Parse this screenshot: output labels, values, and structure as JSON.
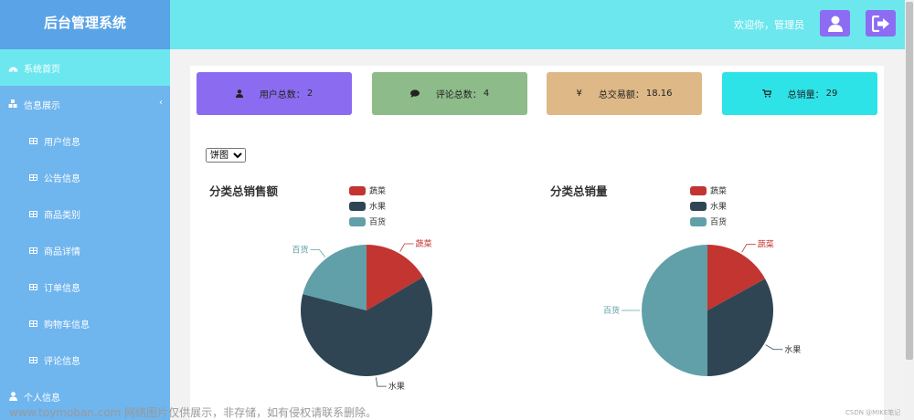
{
  "app": {
    "title": "后台管理系统"
  },
  "header": {
    "welcome": "欢迎你，管理员"
  },
  "sidebar": {
    "items": [
      {
        "label": "系统首页"
      },
      {
        "label": "信息展示"
      },
      {
        "label": "用户信息"
      },
      {
        "label": "公告信息"
      },
      {
        "label": "商品类别"
      },
      {
        "label": "商品详情"
      },
      {
        "label": "订单信息"
      },
      {
        "label": "购物车信息"
      },
      {
        "label": "评论信息"
      },
      {
        "label": "个人信息"
      }
    ]
  },
  "stats": [
    {
      "label": "用户总数：",
      "value": "2",
      "color": "#8b6cf0",
      "icon": "user-icon"
    },
    {
      "label": "评论总数：",
      "value": "4",
      "color": "#8dbb89",
      "icon": "comment-icon"
    },
    {
      "label": "总交易额：",
      "value": "18.16",
      "color": "#deb887",
      "icon": "yen-icon"
    },
    {
      "label": "总销量：",
      "value": "29",
      "color": "#2ee3e8",
      "icon": "cart-icon"
    }
  ],
  "chart_select": {
    "selected": "饼图",
    "options": [
      "饼图"
    ]
  },
  "charts_meta": {
    "legend": [
      {
        "name": "蔬菜",
        "color": "#c23531"
      },
      {
        "name": "水果",
        "color": "#2f4554"
      },
      {
        "name": "百货",
        "color": "#61a0a8"
      }
    ]
  },
  "chart_data": [
    {
      "type": "pie",
      "title": "分类总销售额",
      "legend_position": "top",
      "slices": [
        {
          "name": "蔬菜",
          "value": 16.5,
          "color": "#c23531"
        },
        {
          "name": "水果",
          "value": 62.5,
          "color": "#2f4554"
        },
        {
          "name": "百货",
          "value": 21.0,
          "color": "#61a0a8"
        }
      ]
    },
    {
      "type": "pie",
      "title": "分类总销量",
      "legend_position": "top",
      "slices": [
        {
          "name": "蔬菜",
          "value": 17,
          "color": "#c23531"
        },
        {
          "name": "水果",
          "value": 33,
          "color": "#2f4554"
        },
        {
          "name": "百货",
          "value": 50,
          "color": "#61a0a8"
        }
      ]
    }
  ],
  "footer": {
    "watermark": "www.toymoban.com 网络图片仅供展示，非存储，如有侵权请联系删除。",
    "csdn": "CSDN @MIKE笔记"
  }
}
